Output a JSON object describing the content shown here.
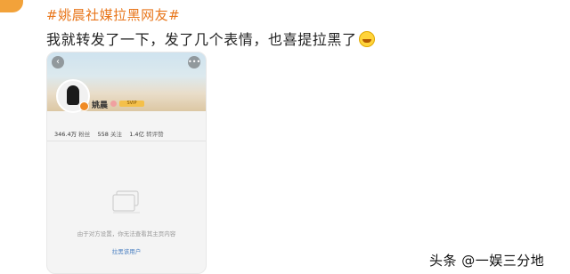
{
  "hashtag": "#姚晨社媒拉黑网友#",
  "post_text": "我就转发了一下，发了几个表情，也喜提拉黑了",
  "emoji": "laughing-tears-emoji",
  "profile": {
    "name": "姚晨",
    "vip_label": "SVIP",
    "stats": {
      "fans_value": "346.4万",
      "fans_label": "粉丝",
      "follow_value": "558",
      "follow_label": "关注",
      "likes_value": "1.4亿",
      "likes_label": "转评赞"
    },
    "empty_message": "由于对方设置，你无法查看其主页内容",
    "unblock_label": "拉黑该用户"
  },
  "watermark": "头条 @一娱三分地",
  "colors": {
    "hashtag": "#e8761b",
    "link": "#4a7fc1",
    "accent": "#f2a23a"
  }
}
